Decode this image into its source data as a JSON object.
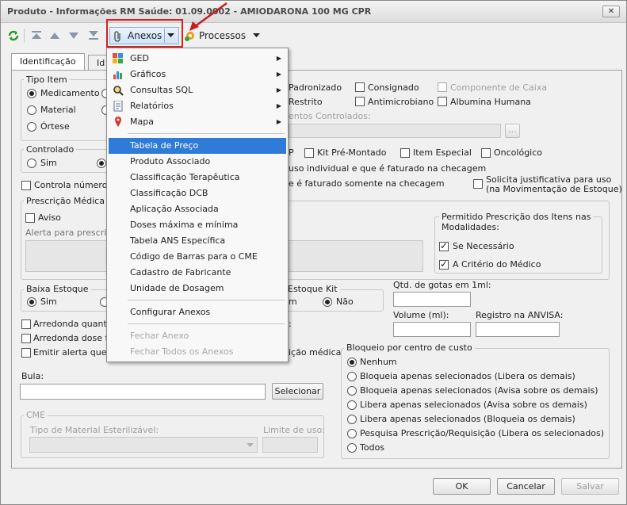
{
  "window": {
    "title": "Produto - Informações RM Saúde: 01.09.0002 - AMIODARONA 100 MG CPR",
    "close": "✕"
  },
  "toolbar": {
    "anexos": "Anexos",
    "processos": "Processos"
  },
  "tabs": [
    "Identificação",
    "Id"
  ],
  "tipo_item": {
    "title": "Tipo Item",
    "options": [
      "Medicamento",
      "Material",
      "Órtese"
    ]
  },
  "flags_top": {
    "padronizado": "Padronizado",
    "consignado": "Consignado",
    "componente_caixa": "Componente de Caixa",
    "restrito": "Restrito",
    "antimicrobiano": "Antimicrobiano",
    "albumina": "Albumina Humana",
    "controlados_label": "entos Controlados:",
    "ellipsis": "..."
  },
  "controlado": {
    "title": "Controlado",
    "sim": "Sim"
  },
  "flags_mid": {
    "p": "P",
    "kit": "Kit Pré-Montado",
    "especial": "Item Especial",
    "oncologico": "Oncológico",
    "uso_individual": "uso individual e que é faturado na checagem",
    "faturado_somente": "e é faturado somente na checagem",
    "solicita": "Solicita justificativa para uso",
    "solicita2": "(na Movimentação de Estoque)"
  },
  "controla_numero": "Controla número c",
  "prescricao": {
    "title": "Prescrição Médica",
    "aviso": "Aviso",
    "alerta": "Alerta para prescriç"
  },
  "permitido": {
    "title1": "Permitido Prescrição dos Itens nas",
    "title2": "Modalidades:",
    "se_necessario": "Se Necessário",
    "a_criterio": "A Critério do Médico"
  },
  "baixa_estoque": {
    "title": "Baixa Estoque",
    "sim": "Sim"
  },
  "estoque_kit": {
    "title": "Estoque Kit",
    "m": "m",
    "nao": "Não"
  },
  "gotas": {
    "label": "Qtd. de gotas em 1ml:",
    "volume": "Volume (ml):",
    "registro": "Registro na ANVISA:"
  },
  "bottom_checks": {
    "arredonda1": "Arredonda quantic",
    "arredonda2": "Arredonda dose fr",
    "emitir": "Emitir alerta que p",
    "emitir_tail": "ição médica",
    "colon": ":"
  },
  "bula": {
    "label": "Bula:",
    "selecionar": "Selecionar"
  },
  "cme": {
    "title": "CME",
    "tipo": "Tipo de Material Esterilizável:",
    "limite": "Limite de uso:"
  },
  "bloqueio": {
    "title": "Bloqueio por centro de custo",
    "options": [
      "Nenhum",
      "Bloqueia apenas selecionados (Libera os demais)",
      "Bloqueia apenas selecionados (Avisa sobre os demais)",
      "Libera apenas selecionados (Avisa sobre os demais)",
      "Libera apenas selecionados (Bloqueia os demais)",
      "Pesquisa Prescrição/Requisição (Libera os selecionados)",
      "Todos"
    ]
  },
  "buttons": {
    "ok": "OK",
    "cancelar": "Cancelar",
    "salvar": "Salvar"
  },
  "menu": {
    "sub": [
      "GED",
      "Gráficos",
      "Consultas SQL",
      "Relatórios",
      "Mapa"
    ],
    "items": [
      "Tabela de Preço",
      "Produto Associado",
      "Classificação Terapêutica",
      "Classificação DCB",
      "Aplicação Associada",
      "Doses máxima e mínima",
      "Tabela ANS Específica",
      "Código de Barras para o CME",
      "Cadastro de Fabricante",
      "Unidade de Dosagem"
    ],
    "configurar": "Configurar Anexos",
    "fechar": "Fechar Anexo",
    "fechar_todos": "Fechar Todos os Anexos"
  },
  "colors": {
    "highlight": "#2f7bd8",
    "annotation_red": "#d42020"
  }
}
